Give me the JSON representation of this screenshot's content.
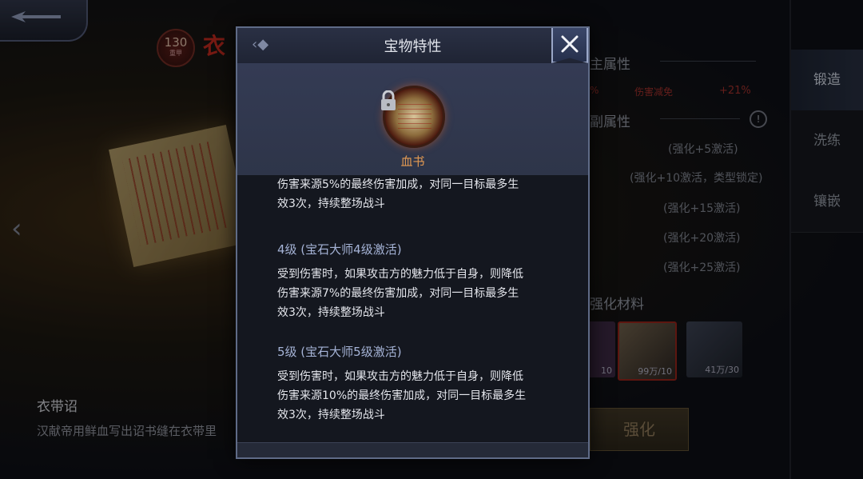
{
  "background": {
    "level_badge": {
      "value": "130",
      "sub": "重甲"
    },
    "title_fragment": "衣",
    "item_name": "衣带诏",
    "item_desc": "汉献帝用鲜血写出诏书缝在衣带里",
    "attr_main": "主属性",
    "attr_sub": "副属性",
    "stat_left": "%",
    "stat_name": "伤害减免",
    "stat_value": "+21%",
    "stat_rows": [
      "(强化+5激活)",
      "(强化+10激活，类型锁定)",
      "(强化+15激活)",
      "(强化+20激活)",
      "(强化+25激活)"
    ],
    "materials_label": "强化材料",
    "materials": [
      {
        "count": "10",
        "icon": "purple-material-icon"
      },
      {
        "count": "99万/10",
        "icon": "blood-scroll-material-icon"
      },
      {
        "count": "41万/30",
        "icon": "iron-ore-material-icon"
      }
    ],
    "enhance_button": "强化",
    "side_tabs": [
      "锻造",
      "洗练",
      "镶嵌"
    ],
    "info_icon": "!"
  },
  "modal": {
    "title": "宝物特性",
    "gem_name": "血书",
    "lines_intro": [
      "伤害来源5%的最终伤害加成，对同一目标最多生",
      "效3次，持续整场战斗"
    ],
    "levels": [
      {
        "label": "4级 (宝石大师4级激活)",
        "lines": [
          "受到伤害时，如果攻击方的魅力低于自身，则降低",
          "伤害来源7%的最终伤害加成，对同一目标最多生",
          "效3次，持续整场战斗"
        ]
      },
      {
        "label": "5级 (宝石大师5级激活)",
        "lines": [
          "受到伤害时，如果攻击方的魅力低于自身，则降低",
          "伤害来源10%的最终伤害加成，对同一目标最多生",
          "效3次，持续整场战斗"
        ]
      }
    ]
  },
  "colors": {
    "gem_name": "#e49a52",
    "level_label": "#a5b3d6",
    "damage_red": "#9b2f2a",
    "accent_frame": "#5f6b87"
  }
}
